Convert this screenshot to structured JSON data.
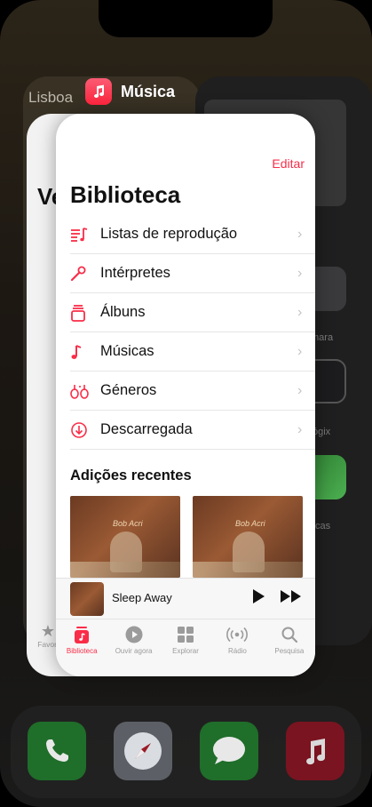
{
  "app_switcher": {
    "app_name": "Música",
    "left_card_label": "Lisboa",
    "back_card_title": "Ve",
    "back_card_tab_label": "Favori",
    "right_card_labels": [
      "mara",
      "ógix",
      "cas"
    ]
  },
  "library": {
    "edit_label": "Editar",
    "title": "Biblioteca",
    "items": [
      {
        "label": "Listas de reprodução",
        "icon": "playlist-icon"
      },
      {
        "label": "Intérpretes",
        "icon": "microphone-icon"
      },
      {
        "label": "Álbuns",
        "icon": "album-stack-icon"
      },
      {
        "label": "Músicas",
        "icon": "music-note-icon"
      },
      {
        "label": "Géneros",
        "icon": "guitars-icon"
      },
      {
        "label": "Descarregada",
        "icon": "download-circle-icon"
      }
    ],
    "recent_title": "Adições recentes"
  },
  "now_playing": {
    "song": "Sleep Away"
  },
  "tabbar": {
    "tabs": [
      {
        "label": "Biblioteca",
        "icon": "library-icon",
        "active": true
      },
      {
        "label": "Ouvir agora",
        "icon": "play-circle-icon",
        "active": false
      },
      {
        "label": "Explorar",
        "icon": "grid-icon",
        "active": false
      },
      {
        "label": "Rádio",
        "icon": "radio-waves-icon",
        "active": false
      },
      {
        "label": "Pesquisa",
        "icon": "magnifier-icon",
        "active": false
      }
    ]
  },
  "colors": {
    "accent": "#fa2d48"
  }
}
